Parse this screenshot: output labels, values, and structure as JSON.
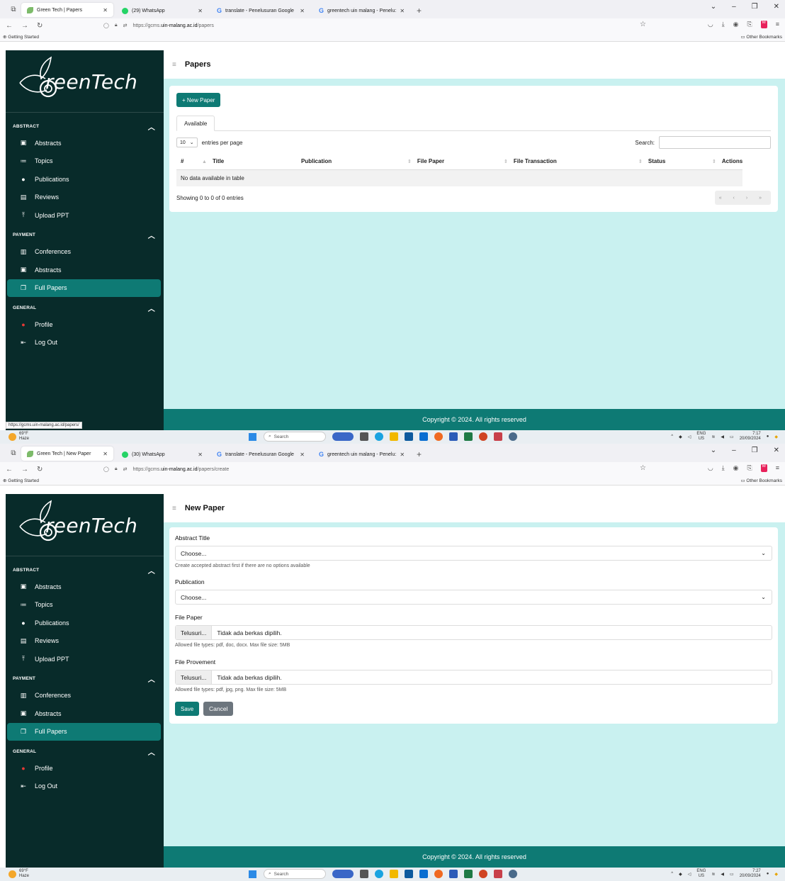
{
  "screens": [
    {
      "tabs": [
        {
          "title": "Green Tech | Papers"
        },
        {
          "title": "(29) WhatsApp"
        },
        {
          "title": "translate - Penelusuran Google"
        },
        {
          "title": "greentech uin malang - Penelu:"
        }
      ],
      "url": {
        "prefix": "https://gcms.",
        "host": "uin-malang.ac.id",
        "path": "/papers"
      },
      "page_title": "Papers",
      "status_url": "https://gcms.uin-malang.ac.id/papers/",
      "taskbar": {
        "temp": "69°F",
        "cond": "Haze",
        "time": "7:17",
        "date": "20/09/2024"
      }
    },
    {
      "tabs": [
        {
          "title": "Green Tech | New Paper"
        },
        {
          "title": "(30) WhatsApp"
        },
        {
          "title": "translate - Penelusuran Google"
        },
        {
          "title": "greentech uin malang - Penelu:"
        }
      ],
      "url": {
        "prefix": "https://gcms.",
        "host": "uin-malang.ac.id",
        "path": "/papers/create"
      },
      "page_title": "New Paper",
      "taskbar": {
        "temp": "69°F",
        "cond": "Haze",
        "time": "7:27",
        "date": "20/09/2024"
      }
    }
  ],
  "browser": {
    "bookmarks_getting_started": "Getting Started",
    "bookmarks_other": "Other Bookmarks",
    "taskbar_search": "Search",
    "taskbar_lang": "ENG",
    "taskbar_region": "US"
  },
  "sidebar": {
    "logo_text": "reenTech",
    "sections": {
      "abstract": "ABSTRACT",
      "payment": "PAYMENT",
      "general": "GENERAL"
    },
    "items": {
      "abstracts": "Abstracts",
      "topics": "Topics",
      "publications": "Publications",
      "reviews": "Reviews",
      "upload_ppt": "Upload PPT",
      "conferences": "Conferences",
      "pay_abstracts": "Abstracts",
      "full_papers": "Full Papers",
      "profile": "Profile",
      "logout": "Log Out"
    }
  },
  "papers": {
    "new_button": "+ New Paper",
    "tab_available": "Available",
    "entries_value": "10",
    "entries_label": "entries per page",
    "search_label": "Search:",
    "columns": [
      "#",
      "Title",
      "Publication",
      "File Paper",
      "File Transaction",
      "Status",
      "Actions"
    ],
    "empty_text": "No data available in table",
    "info": "Showing 0 to 0 of 0 entries",
    "pager": "« ‹ › »"
  },
  "new_paper": {
    "abstract_title_label": "Abstract Title",
    "abstract_title_value": "Choose...",
    "abstract_help": "Create accepted abstract first if there are no options available",
    "publication_label": "Publication",
    "publication_value": "Choose...",
    "file_paper_label": "File Paper",
    "browse_label": "Telusuri...",
    "no_file": "Tidak ada berkas dipilih.",
    "file_paper_help": "Allowed file types: pdf, doc, docx. Max file size: 5MB",
    "file_provement_label": "File Provement",
    "file_provement_help": "Allowed file types: pdf, jpg, png. Max file size: 5MB",
    "save": "Save",
    "cancel": "Cancel"
  },
  "footer": "Copyright © 2024. All rights reserved",
  "colors": {
    "sidebar": "#082b2a",
    "accent": "#0e7a74",
    "content_bg": "#c9f1f0"
  }
}
